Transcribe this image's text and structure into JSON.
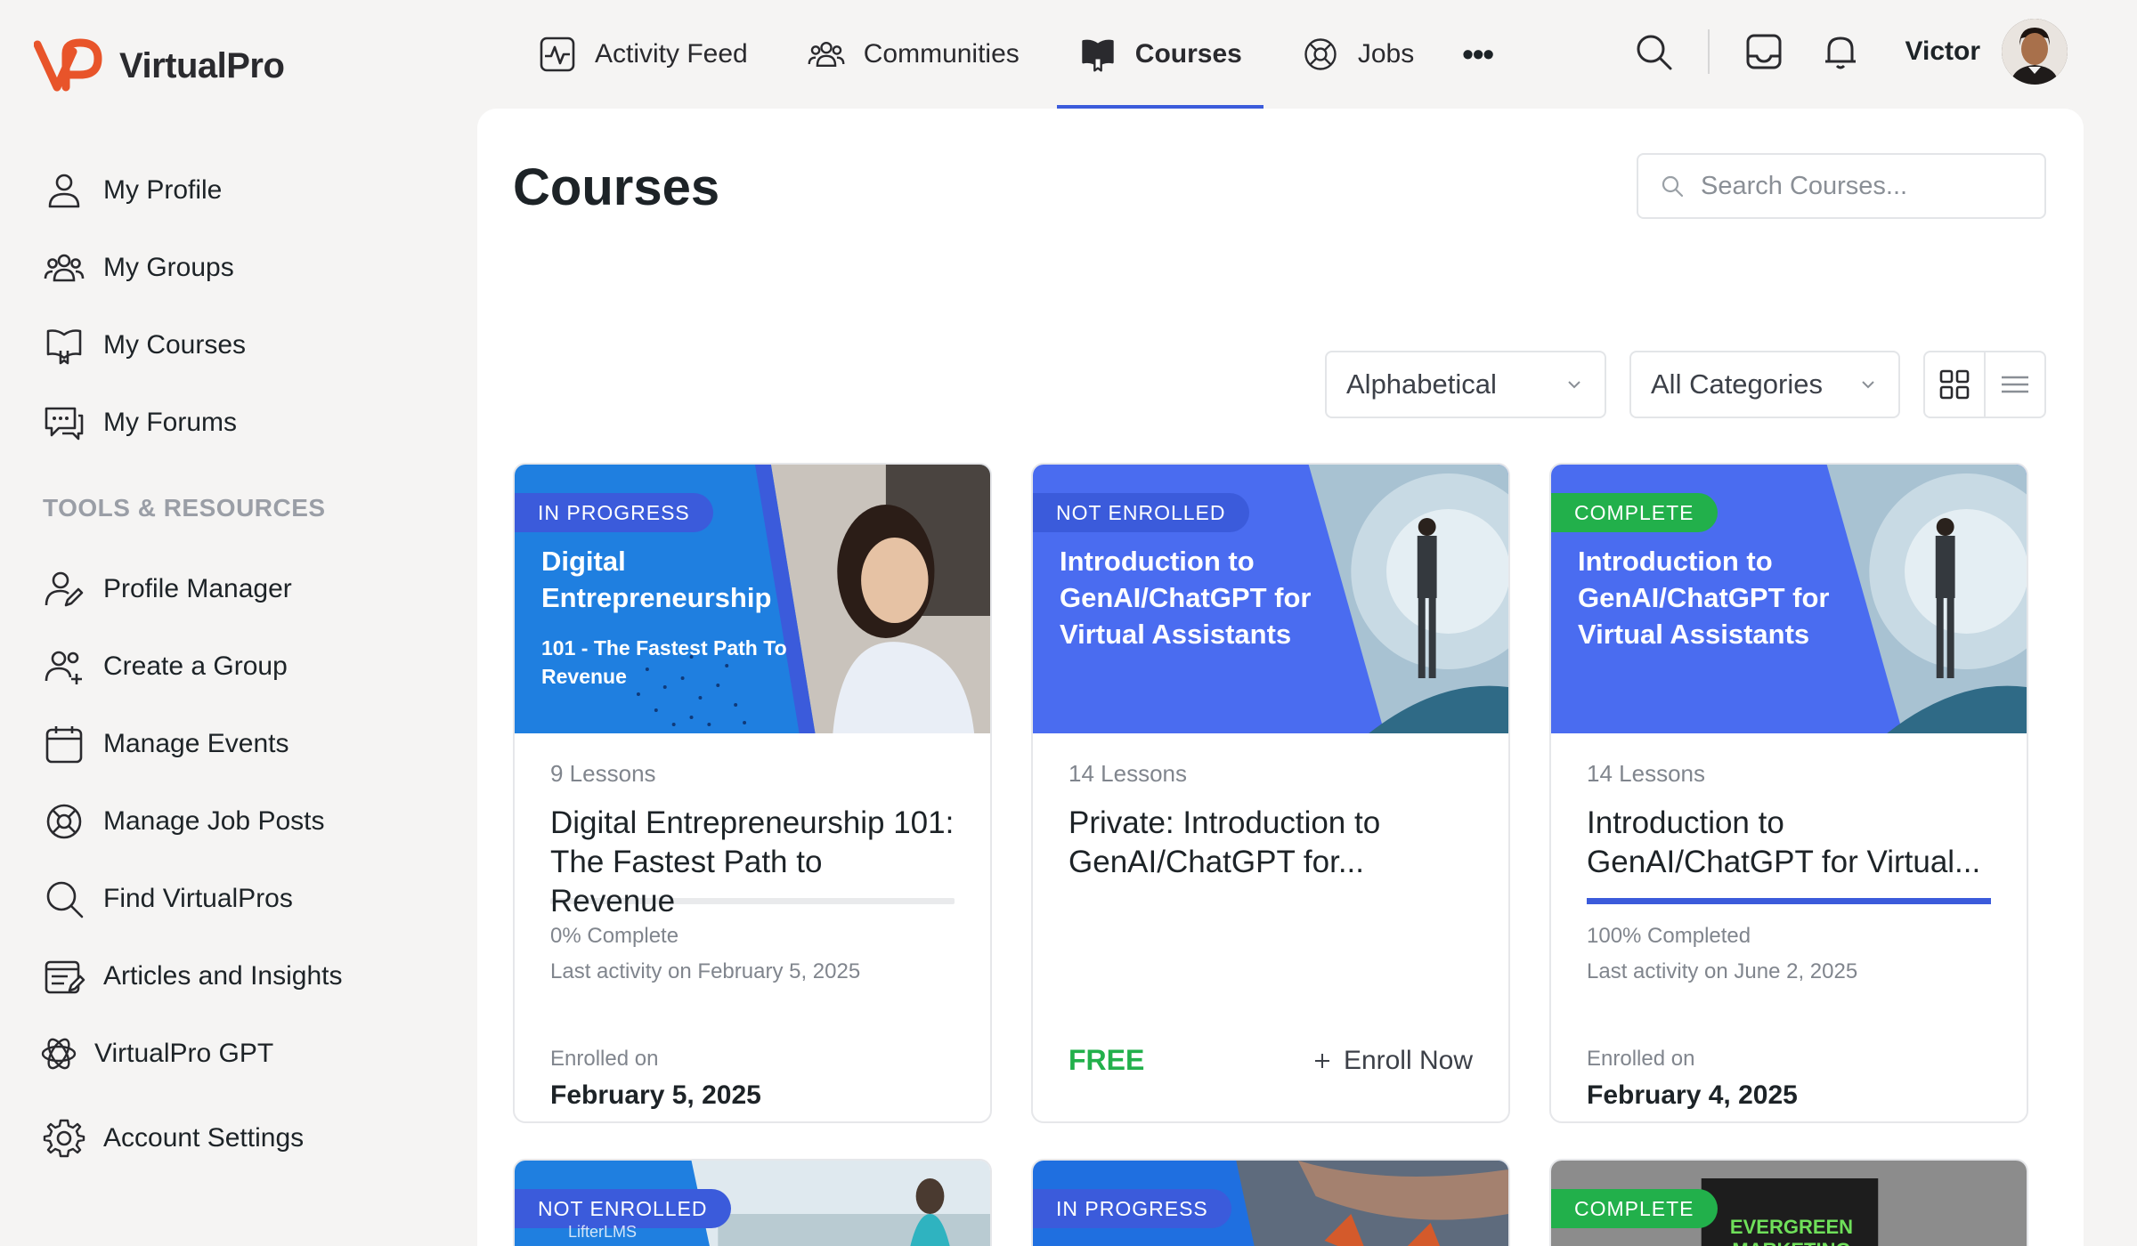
{
  "app": {
    "name": "VirtualPro"
  },
  "sidebar": {
    "items": [
      {
        "label": "My Profile",
        "icon": "user-icon"
      },
      {
        "label": "My Groups",
        "icon": "users-icon"
      },
      {
        "label": "My Courses",
        "icon": "courses-icon"
      },
      {
        "label": "My Forums",
        "icon": "forums-icon"
      }
    ],
    "section_heading": "TOOLS & RESOURCES",
    "tools": [
      {
        "label": "Profile Manager",
        "icon": "user-edit-icon"
      },
      {
        "label": "Create a Group",
        "icon": "user-add-icon"
      },
      {
        "label": "Manage Events",
        "icon": "calendar-icon"
      },
      {
        "label": "Manage Job Posts",
        "icon": "lifebuoy-icon"
      },
      {
        "label": "Find VirtualPros",
        "icon": "search-icon"
      },
      {
        "label": "Articles and Insights",
        "icon": "articles-icon"
      },
      {
        "label": "VirtualPro GPT",
        "icon": "gpt-icon"
      },
      {
        "label": "Account Settings",
        "icon": "gear-icon"
      }
    ]
  },
  "topnav": {
    "tabs": [
      {
        "label": "Activity Feed",
        "icon": "activity-icon"
      },
      {
        "label": "Communities",
        "icon": "users-icon"
      },
      {
        "label": "Courses",
        "icon": "courses-icon",
        "active": true
      },
      {
        "label": "Jobs",
        "icon": "lifebuoy-icon"
      }
    ],
    "more": "•••",
    "username": "Victor"
  },
  "main": {
    "title": "Courses",
    "search_placeholder": "Search Courses...",
    "sort_selected": "Alphabetical",
    "category_selected": "All Categories"
  },
  "cards": [
    {
      "status": "IN PROGRESS",
      "thumb_title": "Digital Entrepreneurship",
      "thumb_sub": "101 - The Fastest Path To Revenue",
      "lessons": "9 Lessons",
      "title": "Digital Entrepreneurship 101: The Fastest Path to Revenue",
      "progress": 0,
      "percent_text": "0% Complete",
      "last_activity": "Last activity on February 5, 2025",
      "enrolled_label": "Enrolled on",
      "enrolled_date": "February 5, 2025"
    },
    {
      "status": "NOT ENROLLED",
      "thumb_title": "Introduction to GenAI/ChatGPT for Virtual Assistants",
      "lessons": "14 Lessons",
      "title": "Private: Introduction to GenAI/ChatGPT for...",
      "price": "FREE",
      "enroll": "Enroll Now"
    },
    {
      "status": "COMPLETE",
      "thumb_title": "Introduction to GenAI/ChatGPT for Virtual Assistants",
      "lessons": "14 Lessons",
      "title": "Introduction to GenAI/ChatGPT for Virtual...",
      "progress": 100,
      "percent_text": "100% Completed",
      "last_activity": "Last activity on June 2, 2025",
      "enrolled_label": "Enrolled on",
      "enrolled_date": "February 4, 2025"
    }
  ],
  "cards_row2": [
    {
      "status": "NOT ENROLLED",
      "thumb_text": "LifterLMS"
    },
    {
      "status": "IN PROGRESS"
    },
    {
      "status": "COMPLETE",
      "thumb_text": "EVERGREEN MARKETING"
    }
  ],
  "colors": {
    "accent": "#3b5bdb",
    "success": "#22b04b",
    "brand": "#e8542a"
  }
}
